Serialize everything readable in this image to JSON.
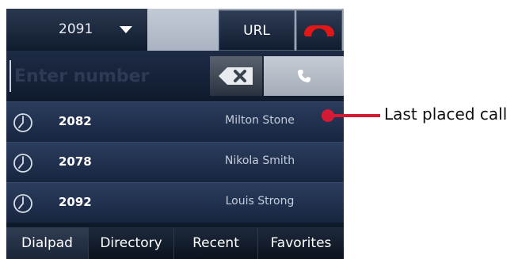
{
  "topbar": {
    "line_number": "2091",
    "url_label": "URL",
    "end_call_icon": "hang-up-icon",
    "colors": {
      "end_call": "#e01818"
    }
  },
  "dialer": {
    "placeholder": "Enter number",
    "value": "",
    "backspace_icon": "backspace-icon",
    "call_icon": "phone-icon"
  },
  "recent_calls": [
    {
      "icon": "clock-icon",
      "number": "2082",
      "name": "Milton Stone"
    },
    {
      "icon": "clock-icon",
      "number": "2078",
      "name": "Nikola Smith"
    },
    {
      "icon": "clock-icon",
      "number": "2092",
      "name": "Louis Strong"
    }
  ],
  "tabs": [
    "Dialpad",
    "Directory",
    "Recent",
    "Favorites"
  ],
  "callout": {
    "label": "Last placed call",
    "color": "#d61a36"
  }
}
